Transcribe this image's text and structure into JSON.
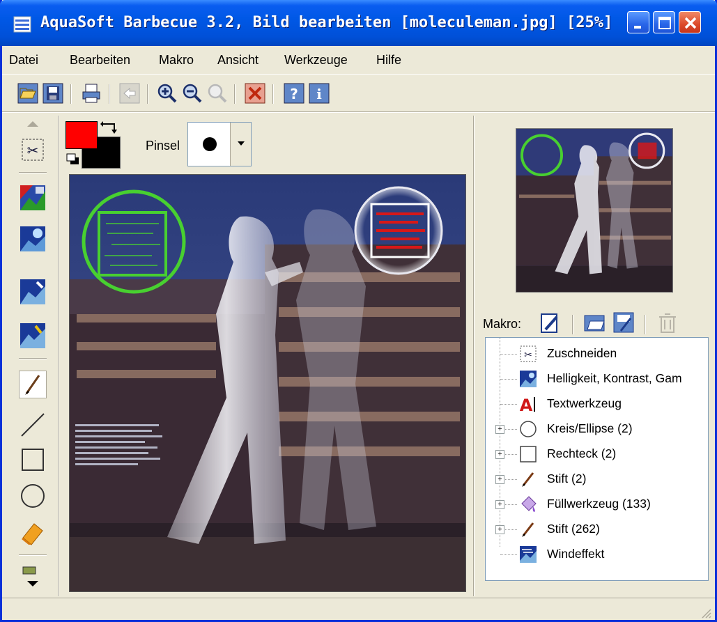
{
  "window": {
    "title": "AquaSoft Barbecue 3.2, Bild bearbeiten [moleculeman.jpg] [25%]"
  },
  "menu": [
    "Datei",
    "Bearbeiten",
    "Makro",
    "Ansicht",
    "Werkzeuge",
    "Hilfe"
  ],
  "toolbar": [
    "open-icon",
    "save-icon",
    "print-icon",
    "back-icon",
    "zoom-in-icon",
    "zoom-out-icon",
    "zoom-fit-icon",
    "cancel-icon",
    "help-icon",
    "info-icon"
  ],
  "colors": {
    "foreground": "#ff0000",
    "background": "#000000",
    "title_bar": "#0058e6",
    "panel": "#ece9d8"
  },
  "brush": {
    "label": "Pinsel",
    "shape": "round"
  },
  "left_tools": [
    "crop-tool-icon",
    "color-tool-icon",
    "brightness-tool-icon",
    "sharpen-tool-icon",
    "wind-tool-icon",
    "brush-tool-icon",
    "line-tool-icon",
    "rectangle-tool-icon",
    "ellipse-tool-icon",
    "eraser-tool-icon",
    "more-tools-icon"
  ],
  "macro": {
    "label": "Makro:",
    "items": [
      {
        "label": "Zuschneiden",
        "icon": "crop-icon",
        "expandable": false
      },
      {
        "label": "Helligkeit, Kontrast, Gam",
        "icon": "brightness-icon",
        "expandable": false
      },
      {
        "label": "Textwerkzeug",
        "icon": "text-tool-icon",
        "expandable": false
      },
      {
        "label": "Kreis/Ellipse (2)",
        "icon": "ellipse-icon",
        "expandable": true
      },
      {
        "label": "Rechteck (2)",
        "icon": "rectangle-icon",
        "expandable": true
      },
      {
        "label": "Stift (2)",
        "icon": "pen-icon",
        "expandable": true
      },
      {
        "label": "Füllwerkzeug (133)",
        "icon": "fill-tool-icon",
        "expandable": true
      },
      {
        "label": "Stift (262)",
        "icon": "pen-icon",
        "expandable": true
      },
      {
        "label": "Windeffekt",
        "icon": "wind-effect-icon",
        "expandable": false
      }
    ]
  }
}
